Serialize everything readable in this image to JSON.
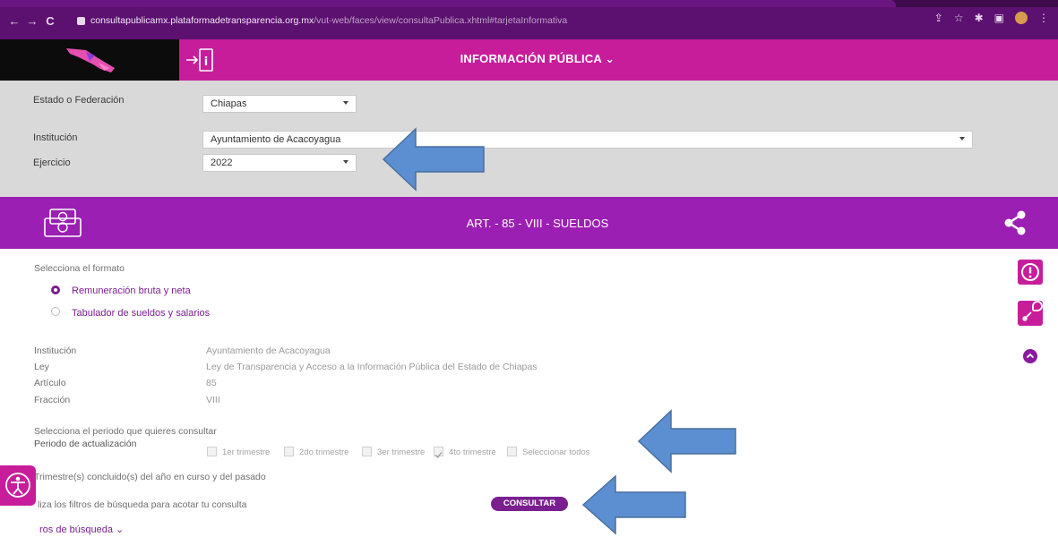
{
  "browser": {
    "url_host": "consultapublicamx.plataformadetransparencia.org.mx",
    "url_path": "/vut-web/faces/view/consultaPublica.xhtml#tarjetaInformativa",
    "nav_back": "←",
    "nav_forward": "→",
    "nav_reload": "C"
  },
  "topbar": {
    "title": "INFORMACIÓN PÚBLICA ⌄"
  },
  "filters": {
    "estado_label": "Estado o Federación",
    "estado_value": "Chiapas",
    "institucion_label": "Institución",
    "institucion_value": "Ayuntamiento de Acacoyagua",
    "ejercicio_label": "Ejercicio",
    "ejercicio_value": "2022"
  },
  "section": {
    "title": "ART. - 85 - VIII - SUELDOS"
  },
  "format": {
    "heading": "Selecciona el formato",
    "options": [
      {
        "label": "Remuneración bruta y neta",
        "selected": true
      },
      {
        "label": "Tabulador de sueldos y salarios",
        "selected": false
      }
    ]
  },
  "details": {
    "institucion_label": "Institución",
    "institucion_value": "Ayuntamiento de Acacoyagua",
    "ley_label": "Ley",
    "ley_value": "Ley de Transparencia y Acceso a la Información Pública del Estado de Chiapas",
    "articulo_label": "Artículo",
    "articulo_value": "85",
    "fraccion_label": "Fracción",
    "fraccion_value": "VIII"
  },
  "periodo": {
    "heading": "Selecciona el periodo que quieres consultar",
    "label": "Periodo de actualización",
    "options": [
      {
        "label": "1er trimestre",
        "checked": false
      },
      {
        "label": "2do trimestre",
        "checked": false
      },
      {
        "label": "3er trimestre",
        "checked": false
      },
      {
        "label": "4to trimestre",
        "checked": true
      },
      {
        "label": "Seleccionar todos",
        "checked": false
      }
    ],
    "note": "Trimestre(s) concluido(s) del año en curso y del pasado"
  },
  "search": {
    "hint": "liza los filtros de búsqueda para acotar tu consulta",
    "consultar_label": "CONSULTAR",
    "filters_link": "ros de búsqueda ⌄"
  },
  "colors": {
    "magenta": "#c71d9b",
    "purple": "#9b1fb2",
    "dark_purple": "#7a1f8f",
    "arrow_blue": "#5b8fd1"
  }
}
